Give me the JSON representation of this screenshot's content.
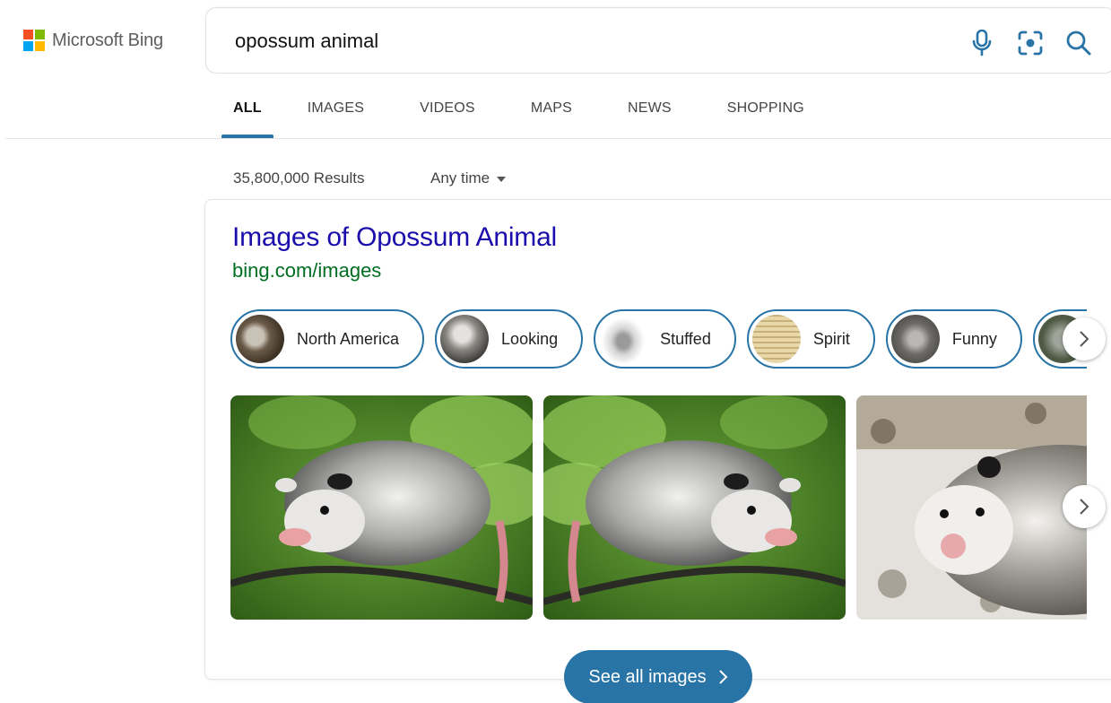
{
  "brand": {
    "name": "Microsoft Bing",
    "logo_colors": [
      "#f25022",
      "#7fba00",
      "#00a4ef",
      "#ffb900"
    ]
  },
  "search": {
    "query": "opossum animal",
    "icons": [
      "microphone-icon",
      "visual-search-icon",
      "search-icon"
    ]
  },
  "tabs": [
    {
      "label": "ALL",
      "active": true
    },
    {
      "label": "IMAGES",
      "active": false
    },
    {
      "label": "VIDEOS",
      "active": false
    },
    {
      "label": "MAPS",
      "active": false
    },
    {
      "label": "NEWS",
      "active": false
    },
    {
      "label": "SHOPPING",
      "active": false
    }
  ],
  "results": {
    "count": "35,800,000 Results",
    "time_filter": "Any time"
  },
  "image_answer": {
    "title": "Images of Opossum Animal",
    "url": "bing.com/images",
    "chips": [
      {
        "label": "North America"
      },
      {
        "label": "Looking"
      },
      {
        "label": "Stuffed"
      },
      {
        "label": "Spirit"
      },
      {
        "label": "Funny"
      },
      {
        "label": ""
      }
    ],
    "see_all_label": "See all images",
    "accent_color": "#2874a6"
  }
}
